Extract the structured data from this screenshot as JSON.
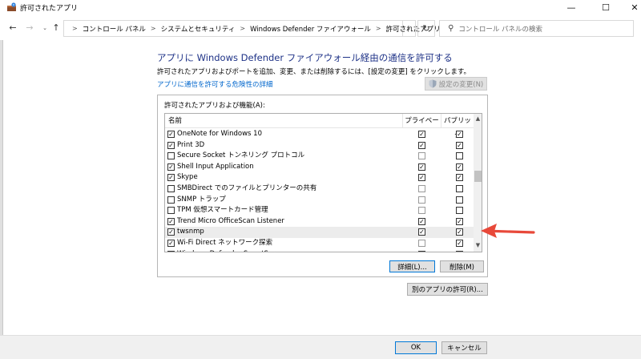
{
  "window": {
    "title": "許可されたアプリ",
    "minimize": "—",
    "maximize": "☐",
    "close": "✕"
  },
  "nav": {
    "back": "←",
    "forward": "→",
    "recent": "⌄",
    "up": "↑",
    "breadcrumbs": [
      "コントロール パネル",
      "システムとセキュリティ",
      "Windows Defender ファイアウォール",
      "許可されたアプリ"
    ],
    "separator": ">",
    "dropdown": "⌄",
    "refresh": "↻",
    "search_placeholder": "コントロール パネルの検索",
    "search_icon": "⚲"
  },
  "main": {
    "heading": "アプリに Windows Defender ファイアウォール経由の通信を許可する",
    "instruction": "許可されたアプリおよびポートを追加、変更、または削除するには、[設定の変更] をクリックします。",
    "risk_link": "アプリに通信を許可する危険性の詳細",
    "change_settings": "設定の変更(N)"
  },
  "list": {
    "group_label": "許可されたアプリおよび機能(A):",
    "columns": {
      "name": "名前",
      "private": "プライベート",
      "public": "パブリック"
    },
    "rows": [
      {
        "name": "OneNote for Windows 10",
        "enabled": true,
        "private": true,
        "public": true
      },
      {
        "name": "Print 3D",
        "enabled": true,
        "private": true,
        "public": true
      },
      {
        "name": "Secure Socket トンネリング プロトコル",
        "enabled": false,
        "private": false,
        "public": false
      },
      {
        "name": "Shell Input Application",
        "enabled": true,
        "private": true,
        "public": true
      },
      {
        "name": "Skype",
        "enabled": true,
        "private": true,
        "public": true
      },
      {
        "name": "SMBDirect でのファイルとプリンターの共有",
        "enabled": false,
        "private": false,
        "public": false
      },
      {
        "name": "SNMP トラップ",
        "enabled": false,
        "private": false,
        "public": false
      },
      {
        "name": "TPM 仮想スマートカード管理",
        "enabled": false,
        "private": false,
        "public": false
      },
      {
        "name": "Trend Micro OfficeScan Listener",
        "enabled": true,
        "private": true,
        "public": true
      },
      {
        "name": "twsnmp",
        "enabled": true,
        "private": true,
        "public": true
      },
      {
        "name": "Wi-Fi Direct ネットワーク探索",
        "enabled": true,
        "private": false,
        "public": true
      },
      {
        "name": "Windows Defender SmartScreen",
        "enabled": true,
        "private": true,
        "public": true
      }
    ],
    "highlight_index": 9,
    "details_button": "詳細(L)...",
    "remove_button": "削除(M)",
    "scroll_up": "▲",
    "scroll_down": "▼"
  },
  "allow_other_button": "別のアプリの許可(R)...",
  "footer": {
    "ok": "OK",
    "cancel": "キャンセル"
  },
  "colors": {
    "heading": "#1e3287",
    "link": "#0066cc",
    "arrow": "#e8493a",
    "focus_border": "#0078d7"
  }
}
